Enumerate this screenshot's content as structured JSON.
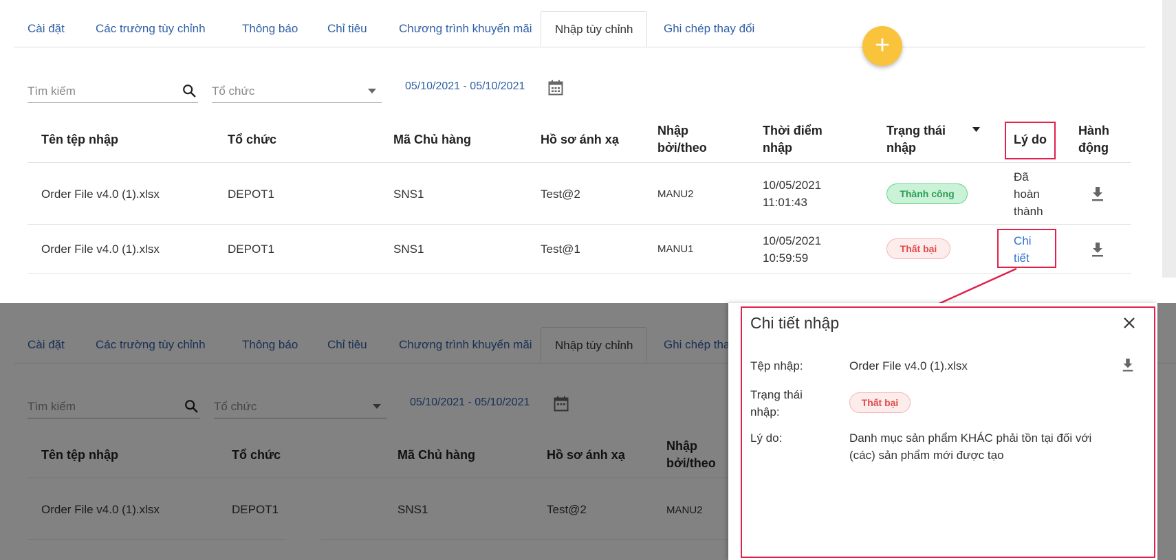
{
  "tabs": [
    {
      "label": "Cài đặt"
    },
    {
      "label": "Các trường tùy chỉnh"
    },
    {
      "label": "Thông báo"
    },
    {
      "label": "Chỉ tiêu"
    },
    {
      "label": "Chương trình khuyến mãi"
    },
    {
      "label": "Nhập tùy chỉnh"
    },
    {
      "label": "Ghi chép thay đổi"
    }
  ],
  "lower_tabs_last_partial": "Ghi chép tha",
  "fab_label": "+",
  "filters": {
    "search_placeholder": "Tìm kiếm",
    "org_placeholder": "Tổ chức",
    "date_range": "05/10/2021 - 05/10/2021"
  },
  "table": {
    "headers": {
      "file": "Tên tệp nhập",
      "org": "Tổ chức",
      "owner": "Mã Chủ hàng",
      "profile": "Hồ sơ ánh xạ",
      "by_1": "Nhập",
      "by_2": "bởi/theo",
      "time_1": "Thời điểm",
      "time_2": "nhập",
      "status_1": "Trạng thái",
      "status_2": "nhập",
      "reason": "Lý do",
      "action_1": "Hành",
      "action_2": "động"
    },
    "rows": [
      {
        "file": "Order File v4.0 (1).xlsx",
        "org": "DEPOT1",
        "owner": "SNS1",
        "profile": "Test@2",
        "by": "MANU2",
        "date": "10/05/2021",
        "time": "11:01:43",
        "status": "Thành công",
        "reason_1": "Đã",
        "reason_2": "hoàn",
        "reason_3": "thành"
      },
      {
        "file": "Order File v4.0 (1).xlsx",
        "org": "DEPOT1",
        "owner": "SNS1",
        "profile": "Test@1",
        "by": "MANU1",
        "date": "10/05/2021",
        "time": "10:59:59",
        "status": "Thất bại",
        "reason_1": "Chi",
        "reason_2": "tiết"
      }
    ]
  },
  "dialog": {
    "title": "Chi tiết nhập",
    "file_label": "Tệp nhập:",
    "file_value": "Order File v4.0 (1).xlsx",
    "status_label_1": "Trạng thái",
    "status_label_2": "nhập:",
    "status_value": "Thất bại",
    "reason_label": "Lý do:",
    "reason_line_1": "Danh mục sản phẩm KHÁC phải tồn tại đối với",
    "reason_line_2": "(các) sản phẩm mới được tạo"
  },
  "colors": {
    "link": "#2f5fa6",
    "fab": "#f9c33b",
    "highlight": "#e2204b",
    "success": "#2e9c57",
    "fail": "#e24a4a"
  }
}
